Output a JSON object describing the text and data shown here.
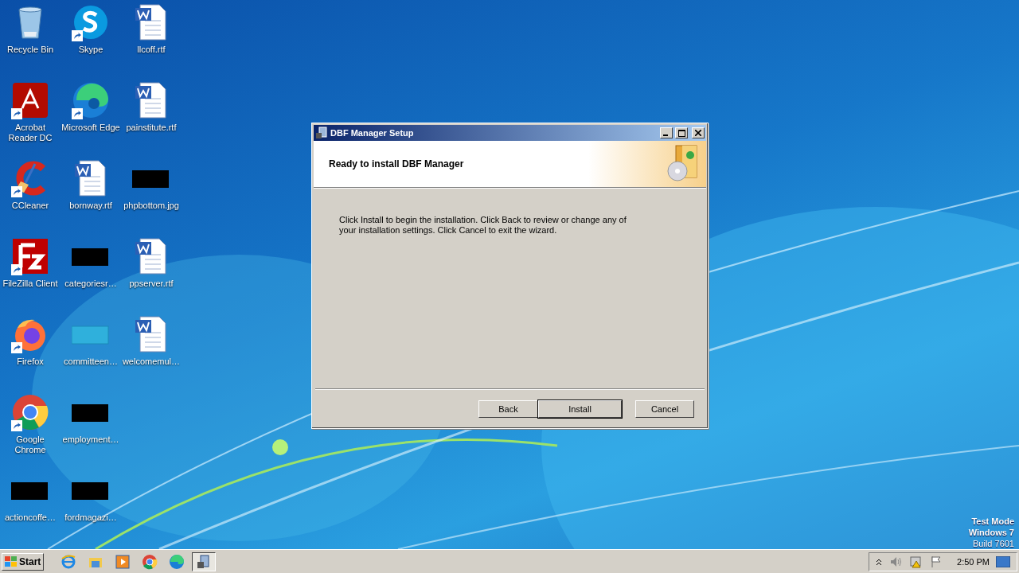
{
  "desktop": {
    "icons": [
      {
        "label": "Recycle Bin",
        "kind": "bin",
        "shortcut": false
      },
      {
        "label": "Acrobat Reader DC",
        "kind": "pdf",
        "shortcut": true
      },
      {
        "label": "CCleaner",
        "kind": "ccleaner",
        "shortcut": true
      },
      {
        "label": "FileZilla Client",
        "kind": "filezilla",
        "shortcut": true
      },
      {
        "label": "Firefox",
        "kind": "firefox",
        "shortcut": true
      },
      {
        "label": "Google Chrome",
        "kind": "chrome",
        "shortcut": true
      },
      {
        "label": "actioncoffe…",
        "kind": "thumbnail",
        "shortcut": false
      },
      {
        "label": "Skype",
        "kind": "skype",
        "shortcut": true
      },
      {
        "label": "Microsoft Edge",
        "kind": "edge",
        "shortcut": true
      },
      {
        "label": "bornway.rtf",
        "kind": "document",
        "shortcut": false
      },
      {
        "label": "categoriesr…",
        "kind": "thumbnail",
        "shortcut": false
      },
      {
        "label": "committeen…",
        "kind": "blank",
        "shortcut": false
      },
      {
        "label": "employment…",
        "kind": "thumbnail",
        "shortcut": false
      },
      {
        "label": "fordmagazi…",
        "kind": "thumbnail",
        "shortcut": false
      },
      {
        "label": "llcoff.rtf",
        "kind": "document",
        "shortcut": false
      },
      {
        "label": "painstitute.rtf",
        "kind": "document",
        "shortcut": false
      },
      {
        "label": "phpbottom.jpg",
        "kind": "thumbnail",
        "shortcut": false
      },
      {
        "label": "ppserver.rtf",
        "kind": "document",
        "shortcut": false
      },
      {
        "label": "welcomemul…",
        "kind": "document",
        "shortcut": false
      }
    ],
    "system_info": [
      "Test Mode",
      "Windows 7",
      "Build 7601"
    ]
  },
  "dialog": {
    "title": "DBF Manager Setup",
    "heading": "Ready to install DBF Manager",
    "message": "Click Install to begin the installation. Click Back to review or change any of your installation settings. Click Cancel to exit the wizard.",
    "buttons": [
      {
        "label": "Back",
        "default": false
      },
      {
        "label": "Install",
        "default": true
      },
      {
        "label": "Cancel",
        "default": false
      }
    ]
  },
  "taskbar": {
    "start": "Start",
    "apps": [
      {
        "kind": "ie",
        "active": false
      },
      {
        "kind": "folder",
        "active": false
      },
      {
        "kind": "media",
        "active": false
      },
      {
        "kind": "chrome",
        "active": false
      },
      {
        "kind": "edge",
        "active": false
      },
      {
        "kind": "setup",
        "active": true
      }
    ],
    "tray": {
      "clock": "2:50 PM"
    }
  }
}
